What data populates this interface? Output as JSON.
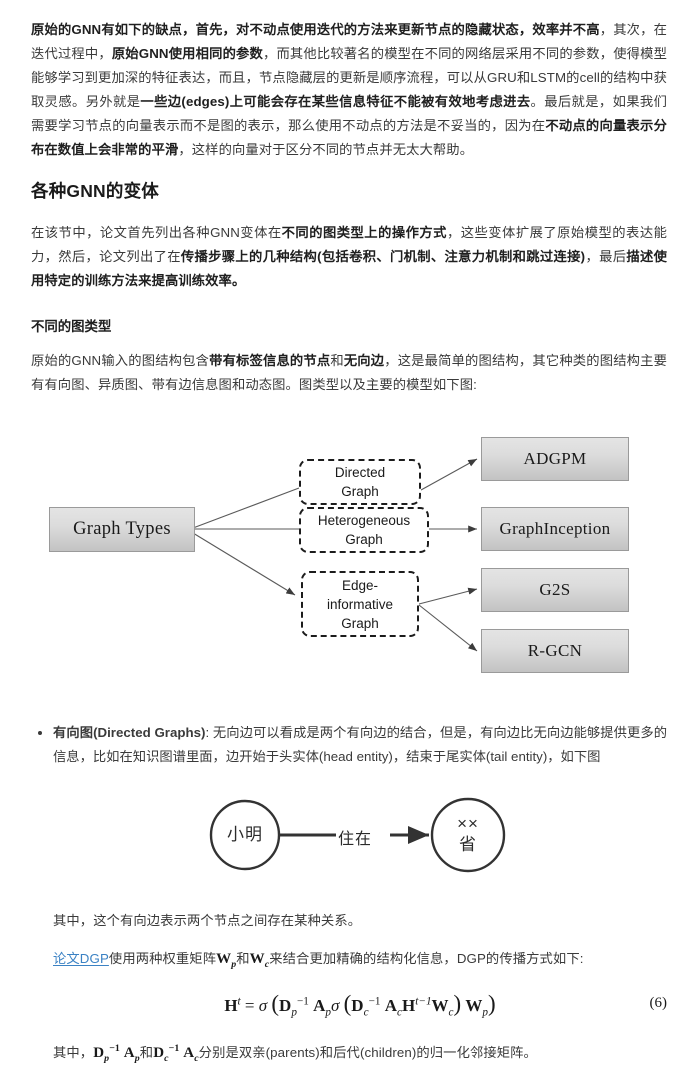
{
  "document": {
    "paragraphs": {
      "p1_parts": [
        {
          "t": "原始的GNN有如下的缺点，首先，",
          "b": true
        },
        {
          "t": "对不动点使用迭代的方法来更新节点的隐藏状态，效率并不高",
          "b": true
        },
        {
          "t": "，其次，在迭代过程中，",
          "b": false
        },
        {
          "t": "原始GNN使用相同的参数",
          "b": true
        },
        {
          "t": "，而其他比较著名的模型在不同的网络层采用不同的参数，使得模型能够学习到更加深的特征表达，而且，节点隐藏层的更新是顺序流程，可以从GRU和LSTM的cell的结构中获取灵感。另外就是",
          "b": false
        },
        {
          "t": "一些边(edges)上可能会存在某些信息特征不能被有效地考虑进去",
          "b": true
        },
        {
          "t": "。最后就是，如果我们需要学习节点的向量表示而不是图的表示，那么使用不动点的方法是不妥当的，因为在",
          "b": false
        },
        {
          "t": "不动点的向量表示分布在数值上会非常的平滑",
          "b": true
        },
        {
          "t": "，这样的向量对于区分不同的节点并无太大帮助。",
          "b": false
        }
      ],
      "p2_parts": [
        {
          "t": "在该节中，论文首先列出各种GNN变体在",
          "b": false
        },
        {
          "t": "不同的图类型上的操作方式",
          "b": true
        },
        {
          "t": "，这些变体扩展了原始模型的表达能力，然后，论文列出了在",
          "b": false
        },
        {
          "t": "传播步骤上的几种结构(包括卷积、门机制、注意力机制和跳过连接)",
          "b": true
        },
        {
          "t": "，最后",
          "b": false
        },
        {
          "t": "描述使用特定的训练方法来提高训练效率。",
          "b": true
        }
      ],
      "p3_parts": [
        {
          "t": "原始的GNN输入的图结构包含",
          "b": false
        },
        {
          "t": "带有标签信息的节点",
          "b": true
        },
        {
          "t": "和",
          "b": false
        },
        {
          "t": "无向边",
          "b": true
        },
        {
          "t": "，这是最简单的图结构，其它种类的图结构主要有有向图、异质图、带有边信息图和动态图。图类型以及主要的模型如下图:",
          "b": false
        }
      ],
      "p4_text": "其中，这个有向边表示两个节点之间存在某种关系。",
      "p5_prefix_link": "论文DGP",
      "p5_parts": [
        {
          "t": "使用两种权重矩阵",
          "b": false
        },
        {
          "t": "和",
          "b": false
        },
        {
          "t": "来结合更加精确的结构化信息，DGP的传播方式如下:",
          "b": false
        }
      ],
      "p6_parts": [
        {
          "t": "其中，",
          "b": false
        },
        {
          "t": "和",
          "b": false
        },
        {
          "t": "分别是双亲(parents)和后代(children)的归一化邻接矩阵。",
          "b": false
        }
      ]
    },
    "headings": {
      "section": "各种GNN的变体",
      "subsection": "不同的图类型"
    },
    "bullets": [
      {
        "label": "有向图(Directed Graphs)",
        "colon": ":",
        "text": "无向边可以看成是两个有向边的结合，但是，有向边比无向边能够提供更多的信息，比如在知识图谱里面，边开始于头实体(head entity)，结束于尾实体(tail entity)，如下图"
      }
    ],
    "formula": {
      "equation_text": "H^t = σ(D_p^{-1} A_p σ(D_c^{-1} A_c H^{t-1} W_c) W_p)",
      "number": "(6)",
      "Wp": "W_p",
      "Wc": "W_c",
      "DpAp": "D_p^{-1} A_p",
      "DcAc": "D_c^{-1} A_c"
    }
  },
  "figure_graph_types": {
    "root": {
      "label": "Graph Types"
    },
    "types": [
      {
        "label": "Directed\nGraph",
        "line1": "Directed",
        "line2": "Graph",
        "line3": ""
      },
      {
        "label": "Heterogeneous\nGraph",
        "line1": "Heterogeneous",
        "line2": "Graph",
        "line3": ""
      },
      {
        "label": "Edge-informative\nGraph",
        "line1": "Edge-",
        "line2": "informative",
        "line3": "Graph"
      }
    ],
    "models": [
      {
        "label": "ADGPM"
      },
      {
        "label": "GraphInception"
      },
      {
        "label": "G2S"
      },
      {
        "label": "R-GCN"
      }
    ],
    "colors": {
      "box_fill_top": "#e4e4e4",
      "box_fill_bottom": "#c3c3c3",
      "box_border": "#9a9a9a",
      "dashed_border": "#1c1c1c",
      "arrow": "#555555"
    }
  },
  "figure_directed_edge": {
    "source_node": "小明",
    "target_node_line1": "××",
    "target_node_line2": "省",
    "edge_label": "住在",
    "colors": {
      "circle_stroke": "#333333",
      "edge_stroke": "#333333"
    }
  }
}
